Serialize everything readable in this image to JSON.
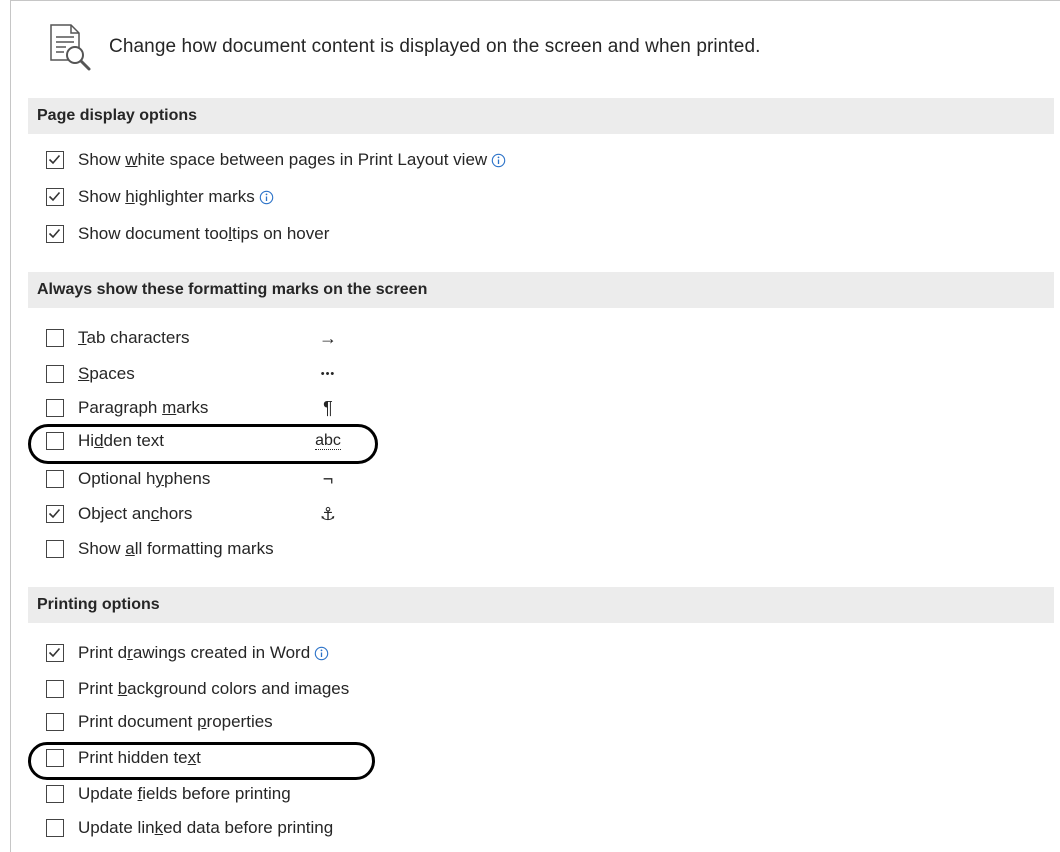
{
  "header": {
    "text": "Change how document content is displayed on the screen and when printed."
  },
  "sections": {
    "page_display": {
      "title": "Page display options",
      "items": [
        {
          "pre": "Show ",
          "key": "w",
          "post": "hite space between pages in Print Layout view",
          "checked": true,
          "info": true
        },
        {
          "pre": "Show ",
          "key": "h",
          "post": "ighlighter marks",
          "checked": true,
          "info": true
        },
        {
          "pre": "Show document too",
          "key": "l",
          "post": "tips on hover",
          "checked": true,
          "info": false
        }
      ]
    },
    "formatting_marks": {
      "title": "Always show these formatting marks on the screen",
      "items": [
        {
          "pre": "",
          "key": "T",
          "post": "ab characters",
          "checked": false,
          "mark": "→"
        },
        {
          "pre": "",
          "key": "S",
          "post": "paces",
          "checked": false,
          "mark": "•••"
        },
        {
          "pre": "Paragraph ",
          "key": "m",
          "post": "arks",
          "checked": false,
          "mark": "¶"
        },
        {
          "pre": "Hi",
          "key": "d",
          "post": "den text",
          "checked": false,
          "mark": "abc"
        },
        {
          "pre": "Optional h",
          "key": "y",
          "post": "phens",
          "checked": false,
          "mark": "¬"
        },
        {
          "pre": "Object an",
          "key": "c",
          "post": "hors",
          "checked": true,
          "mark": "⚓"
        },
        {
          "pre": "Show ",
          "key": "a",
          "post": "ll formatting marks",
          "checked": false,
          "mark": ""
        }
      ]
    },
    "printing": {
      "title": "Printing options",
      "items": [
        {
          "pre": "Print d",
          "key": "r",
          "post": "awings created in Word",
          "checked": true,
          "info": true
        },
        {
          "pre": "Print ",
          "key": "b",
          "post": "ackground colors and images",
          "checked": false,
          "info": false
        },
        {
          "pre": "Print document ",
          "key": "p",
          "post": "roperties",
          "checked": false,
          "info": false
        },
        {
          "pre": "Print hidden te",
          "key": "x",
          "post": "t",
          "checked": false,
          "info": false
        },
        {
          "pre": "Update ",
          "key": "f",
          "post": "ields before printing",
          "checked": false,
          "info": false
        },
        {
          "pre": "Update lin",
          "key": "k",
          "post": "ed data before printing",
          "checked": false,
          "info": false
        }
      ]
    }
  },
  "icons": {
    "header": "document-magnifier-icon",
    "info": "info-circle-icon",
    "checkmark": "checkmark-icon"
  },
  "colors": {
    "section_bg": "#ececec",
    "text": "#262626",
    "info_blue": "#2b72c8",
    "highlight_oval": "#000000"
  }
}
